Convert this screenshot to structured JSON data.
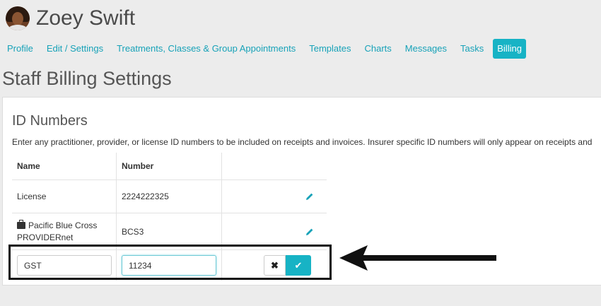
{
  "user": {
    "name": "Zoey Swift"
  },
  "tabs": [
    {
      "label": "Profile",
      "active": false
    },
    {
      "label": "Edit / Settings",
      "active": false
    },
    {
      "label": "Treatments, Classes & Group Appointments",
      "active": false
    },
    {
      "label": "Templates",
      "active": false
    },
    {
      "label": "Charts",
      "active": false
    },
    {
      "label": "Messages",
      "active": false
    },
    {
      "label": "Tasks",
      "active": false
    },
    {
      "label": "Billing",
      "active": true
    }
  ],
  "page": {
    "title": "Staff Billing Settings"
  },
  "id_numbers": {
    "title": "ID Numbers",
    "description": "Enter any practitioner, provider, or license ID numbers to be included on receipts and invoices. Insurer specific ID numbers will only appear on receipts and",
    "columns": {
      "name": "Name",
      "number": "Number"
    },
    "rows": [
      {
        "name": "License",
        "number": "2224222325"
      },
      {
        "name": "Pacific Blue Cross PROVIDERnet",
        "number": "BCS3"
      }
    ],
    "edit_row": {
      "name_value": "GST",
      "number_value": "11234"
    }
  },
  "icons": {
    "edit": "pencil-icon",
    "insurer": "briefcase-icon",
    "cancel": "close-icon",
    "save": "check-icon"
  },
  "colors": {
    "accent": "#17b3c5",
    "link": "#17a2b8"
  }
}
